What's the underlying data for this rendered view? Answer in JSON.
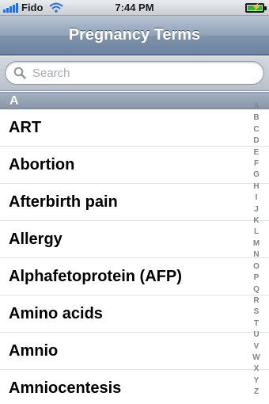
{
  "status_bar": {
    "carrier": "Fido",
    "time": "7:44 PM",
    "icons": [
      "signal-bars-icon",
      "wifi-icon",
      "battery-charging-icon"
    ]
  },
  "nav": {
    "title": "Pregnancy Terms"
  },
  "search": {
    "placeholder": "Search"
  },
  "section": {
    "header": "A"
  },
  "list": {
    "items": [
      {
        "label": "ART"
      },
      {
        "label": "Abortion"
      },
      {
        "label": "Afterbirth pain"
      },
      {
        "label": "Allergy"
      },
      {
        "label": "Alphafetoprotein (AFP)"
      },
      {
        "label": "Amino acids"
      },
      {
        "label": "Amnio"
      },
      {
        "label": "Amniocentesis"
      }
    ]
  },
  "index": {
    "letters": [
      "A",
      "B",
      "C",
      "D",
      "E",
      "F",
      "G",
      "H",
      "I",
      "J",
      "K",
      "L",
      "M",
      "N",
      "O",
      "P",
      "Q",
      "R",
      "S",
      "T",
      "U",
      "V",
      "W",
      "X",
      "Y",
      "Z"
    ]
  },
  "colors": {
    "nav_bar": "#7f93ab",
    "section_header": "#8896a7",
    "battery_fill": "#2eb82e",
    "signal": "#2b6fd6"
  }
}
